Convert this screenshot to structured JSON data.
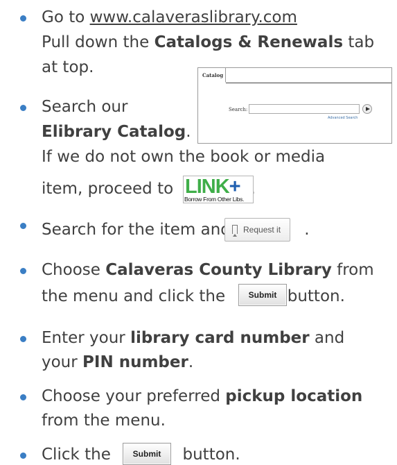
{
  "colors": {
    "bullet": "#3a7ec4",
    "text": "#404040",
    "linkplus_green": "#3fae49",
    "linkplus_blue": "#1f5fb0"
  },
  "steps": {
    "s1": {
      "pre": "Go to ",
      "url": "www.calaveraslibrary.com",
      "line2_pre": "Pull down the ",
      "line2_bold": "Catalogs & Renewals",
      "line2_post": " tab",
      "line3": "at top."
    },
    "s2": {
      "line1": "Search our",
      "line2_bold": "Elibrary Catalog",
      "line2_post": ".",
      "line3": "If we do not own the book or media",
      "line4_pre": "item, proceed to ",
      "line4_post": "."
    },
    "s3": {
      "pre": "Search for the item and ",
      "post": "."
    },
    "s4": {
      "pre": "Choose ",
      "bold": "Calaveras County Library",
      "post": " from",
      "line2_pre": "the menu and click the ",
      "line2_post": " button."
    },
    "s5": {
      "pre": "Enter your ",
      "bold": "library card number",
      "post": " and",
      "line2_pre": "your ",
      "line2_bold": "PIN number",
      "line2_post": "."
    },
    "s6": {
      "pre": "Choose your preferred ",
      "bold": "pickup location",
      "line2": "from the menu."
    },
    "s7": {
      "pre": "Click the ",
      "post": " button."
    }
  },
  "catalog_widget": {
    "tab": "Catalog",
    "search_label": "Search:",
    "advanced": "Advanced Search"
  },
  "linkplus": {
    "word": "LINK",
    "plus": "+",
    "tagline": "Borrow From Other Libs."
  },
  "request_button": {
    "label": "Request it"
  },
  "submit_button": {
    "label": "Submit"
  }
}
